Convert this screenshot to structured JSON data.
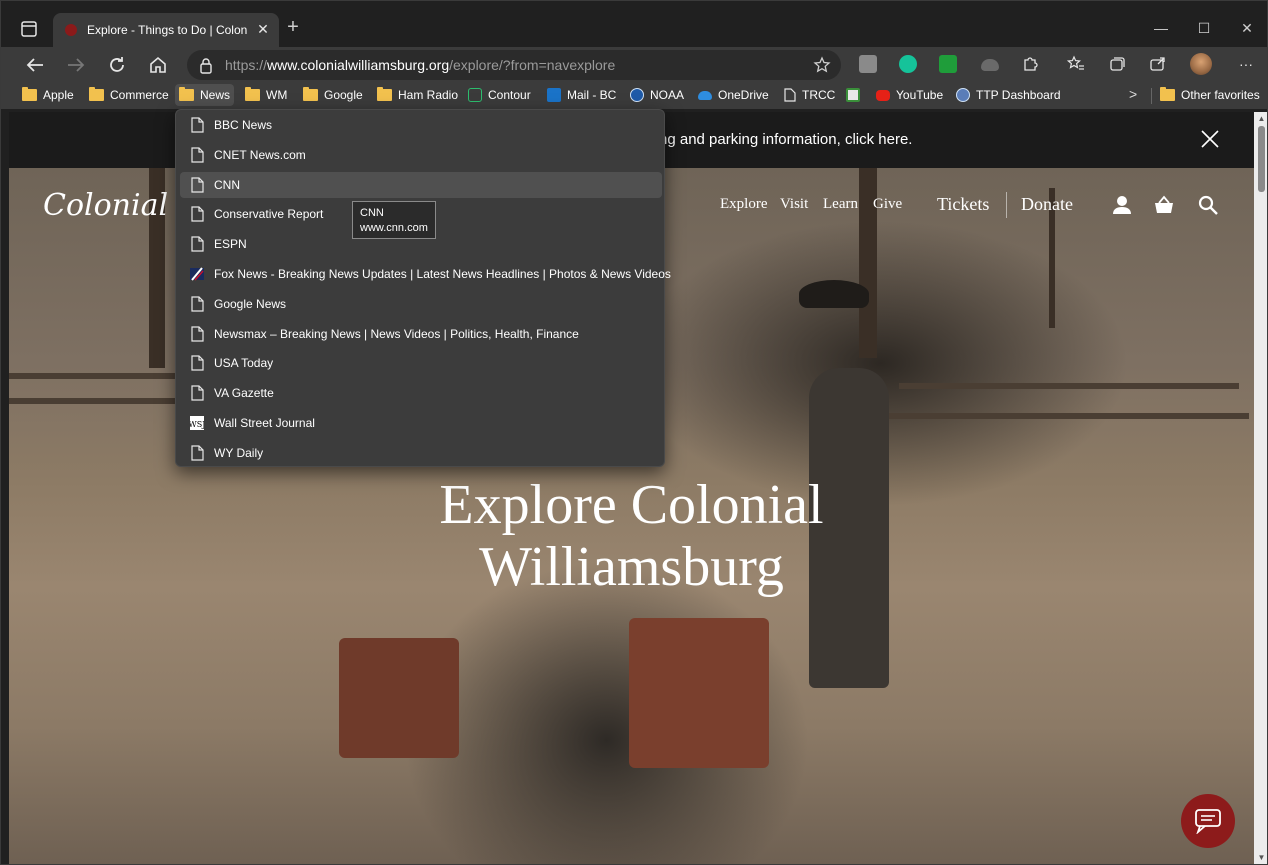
{
  "browser": {
    "tab": {
      "title": "Explore - Things to Do | Colonial",
      "close_glyph": "✕"
    },
    "new_tab_glyph": "+",
    "window_controls": {
      "minimize": "—",
      "maximize": "☐",
      "close": "✕"
    },
    "address": {
      "scheme": "https://",
      "host": "www.colonialwilliamsburg.org",
      "path": "/explore/?from=navexplore"
    },
    "more_glyph": "···"
  },
  "favorites": {
    "items": [
      {
        "label": "Apple",
        "icon": "folder-icon"
      },
      {
        "label": "Commerce",
        "icon": "folder-icon"
      },
      {
        "label": "News",
        "icon": "folder-icon"
      },
      {
        "label": "WM",
        "icon": "folder-icon"
      },
      {
        "label": "Google",
        "icon": "folder-icon"
      },
      {
        "label": "Ham Radio",
        "icon": "folder-icon"
      },
      {
        "label": "Contour",
        "icon": "contour-icon"
      },
      {
        "label": "Mail - BC",
        "icon": "outlook-icon"
      },
      {
        "label": "NOAA",
        "icon": "noaa-icon"
      },
      {
        "label": "OneDrive",
        "icon": "onedrive-icon"
      },
      {
        "label": "TRCC",
        "icon": "page-icon"
      },
      {
        "label": "",
        "icon": "calendar-app-icon"
      },
      {
        "label": "YouTube",
        "icon": "youtube-icon"
      },
      {
        "label": "TTP Dashboard",
        "icon": "dashboard-icon"
      }
    ],
    "overflow_glyph": ">",
    "other": "Other favorites"
  },
  "news_menu": {
    "items": [
      {
        "label": "BBC News",
        "icon": "page-icon"
      },
      {
        "label": "CNET News.com",
        "icon": "page-icon"
      },
      {
        "label": "CNN",
        "icon": "page-icon"
      },
      {
        "label": "Conservative Report",
        "icon": "page-icon"
      },
      {
        "label": "ESPN",
        "icon": "page-icon"
      },
      {
        "label": "Fox News - Breaking News Updates | Latest News Headlines | Photos & News Videos",
        "icon": "fox-news-icon"
      },
      {
        "label": "Google News",
        "icon": "page-icon"
      },
      {
        "label": "Newsmax – Breaking News | News Videos | Politics, Health, Finance",
        "icon": "page-icon"
      },
      {
        "label": "USA Today",
        "icon": "page-icon"
      },
      {
        "label": "VA Gazette",
        "icon": "page-icon"
      },
      {
        "label": "Wall Street Journal",
        "icon": "wsj-icon"
      },
      {
        "label": "WY Daily",
        "icon": "page-icon"
      }
    ],
    "hovered": "CNN",
    "tooltip": {
      "title": "CNN",
      "url": "www.cnn.com"
    }
  },
  "site": {
    "banner_text": "ng and parking information, click here.",
    "logo": "Colonial Wi",
    "nav": {
      "explore": "Explore",
      "visit": "Visit",
      "learn": "Learn",
      "give": "Give",
      "tickets": "Tickets",
      "donate": "Donate"
    },
    "hero_title_line1": "Explore Colonial",
    "hero_title_line2": "Williamsburg"
  },
  "colors": {
    "accent_red": "#8d1b1b",
    "folder_yellow": "#f2c14e",
    "menu_bg": "#3c3c3c",
    "hover_bg": "#505050"
  }
}
